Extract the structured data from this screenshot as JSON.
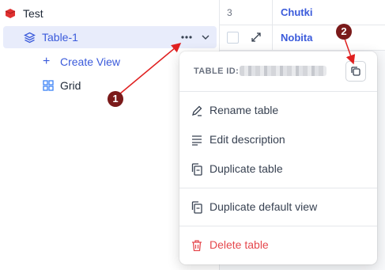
{
  "sidebar": {
    "base": {
      "label": "Test",
      "icon": "database-icon",
      "color": "#e03131"
    },
    "table": {
      "label": "Table-1",
      "icon": "table-icon",
      "more_icon": "more-horizontal-icon",
      "chevron_icon": "chevron-down-icon"
    },
    "create_view": {
      "label": "Create View",
      "icon": "plus-icon"
    },
    "grid": {
      "label": "Grid",
      "icon": "grid-icon"
    }
  },
  "grid": {
    "rows": [
      {
        "number": "3",
        "value": "Chutki"
      },
      {
        "number": "",
        "value": "Nobita",
        "expand_icon": "expand-icon"
      }
    ]
  },
  "menu": {
    "table_id_label": "TABLE ID:",
    "copy_icon": "copy-icon",
    "items": [
      {
        "label": "Rename table",
        "icon": "pencil-icon"
      },
      {
        "label": "Edit description",
        "icon": "align-left-icon"
      },
      {
        "label": "Duplicate table",
        "icon": "duplicate-icon"
      },
      {
        "label": "Duplicate default view",
        "icon": "duplicate-icon"
      },
      {
        "label": "Delete table",
        "icon": "trash-icon",
        "color": "#e5484d"
      }
    ]
  },
  "annotations": {
    "step1": "1",
    "step2": "2",
    "color": "#e02020"
  }
}
